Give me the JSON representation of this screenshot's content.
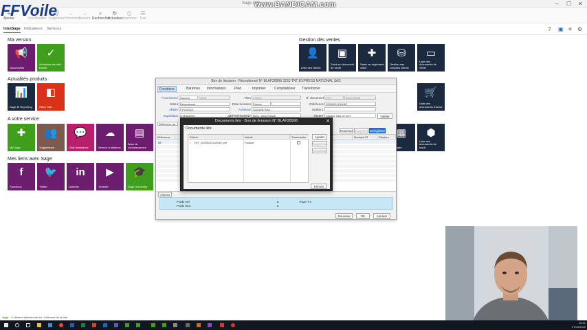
{
  "window": {
    "title": "Sage 100",
    "watermark": "www.BANDICAM.com"
  },
  "logo": {
    "text": "FFVoile"
  },
  "ribbon": {
    "buttons": [
      {
        "label": "Ajouter",
        "icon": "plus-icon"
      },
      {
        "label": "Voir/Modifier",
        "icon": "pencil-icon"
      },
      {
        "label": "Supprimer",
        "icon": "trash-icon"
      },
      {
        "label": "Précédent",
        "icon": "arrow-left-icon"
      },
      {
        "label": "Suivant",
        "icon": "arrow-right-icon"
      },
      {
        "label": "Rechercher",
        "icon": "search-icon"
      },
      {
        "label": "Actualiser",
        "icon": "refresh-icon"
      },
      {
        "label": "Imprimer",
        "icon": "printer-icon"
      },
      {
        "label": "Trier",
        "icon": "sort-icon"
      }
    ]
  },
  "subtabs": [
    "IntuiSage",
    "Indicateurs",
    "Services"
  ],
  "sections": {
    "version": "Ma version",
    "actualites": "Actualités produits",
    "service": "A votre service",
    "liens": "Mes liens avec Sage",
    "ventes": "Gestion des ventes"
  },
  "tiles": {
    "version": [
      {
        "label": "Nouveautés",
        "icon": "megaphone-icon",
        "color": "#6c1d6e"
      },
      {
        "label": "Actualiser les anti-fraude",
        "icon": "check-circle-icon",
        "color": "#3f9e1b"
      }
    ],
    "actualites": [
      {
        "label": "Sage BI Reporting",
        "icon": "bar-chart-icon",
        "color": "#1c2a40"
      },
      {
        "label": "Office 365",
        "icon": "office-icon",
        "color": "#d8331a"
      }
    ],
    "service": [
      {
        "label": "My Sage",
        "icon": "puzzle-icon",
        "color": "#3f9e1b"
      },
      {
        "label": "Suggestions",
        "icon": "people-icon",
        "color": "#7d5a4e"
      },
      {
        "label": "Chat Assistance",
        "icon": "chat-icon",
        "color": "#b8206c"
      },
      {
        "label": "Service à distance",
        "icon": "remote-icon",
        "color": "#6c1d6e"
      },
      {
        "label": "Base de connaissances",
        "icon": "book-icon",
        "color": "#6c1d6e"
      }
    ],
    "liens": [
      {
        "label": "Facebook",
        "glyph": "f",
        "icon": "facebook-icon",
        "color": "#6c1d6e"
      },
      {
        "label": "Twitter",
        "glyph": "🐦",
        "icon": "twitter-icon",
        "color": "#6c1d6e"
      },
      {
        "label": "LinkedIn",
        "glyph": "in",
        "icon": "linkedin-icon",
        "color": "#6c1d6e"
      },
      {
        "label": "Youtube",
        "glyph": "▶",
        "icon": "youtube-icon",
        "color": "#6c1d6e"
      },
      {
        "label": "Sage University",
        "glyph": "🎓",
        "icon": "graduation-icon",
        "color": "#3f9e1b"
      }
    ],
    "ventes": [
      {
        "label": "Liste des clients",
        "icon": "user-icon"
      },
      {
        "label": "Saisir un document de vente",
        "icon": "plus-doc-icon"
      },
      {
        "label": "Saisir un règlement client",
        "icon": "plus-icon"
      },
      {
        "label": "Gestion des comptes clients",
        "icon": "database-icon"
      },
      {
        "label": "Liste des documents de vente",
        "icon": "folder-icon"
      }
    ],
    "ventes_right": [
      {
        "label": "Liste des documents d'achat",
        "icon": "cart-icon"
      },
      {
        "label": "Inventaire",
        "icon": "stock-icon"
      },
      {
        "label": "Liste des documents de stock",
        "icon": "box-icon"
      }
    ]
  },
  "bl_dialog": {
    "title": "Bon de livraison : Réceptionné N° BLAF28998 3230 TNT EXPRESS NATIONAL SAS",
    "toolbar": [
      "Fonctions",
      "Barèmes",
      "Informations",
      "Pied",
      "Imprimer",
      "Comptabiliser",
      "Transformer"
    ],
    "fields": {
      "fournisseur_label": "Fournisseur",
      "fournisseur_type": "Numéro",
      "fournisseur_value": "3230",
      "tiers_label": "Tiers",
      "tiers_value": "0TNEX",
      "ndoc_label": "N° document",
      "ndoc_prefix": "FFV",
      "ndoc_value": "BLAF28998",
      "statut_label": "Statut",
      "statut_value": "Réceptionné",
      "dateliv_label": "Date livraison",
      "dateliv_value": "Prévue",
      "reference_label": "Référence",
      "reference_value": "20200241215067",
      "affaire_label": "Affaire",
      "affaire_value": "FTV01018",
      "acheteur_label": "Acheteur",
      "acheteur_value": "GAUDIN Paul",
      "entete_label": "Entête 1",
      "expedition_label": "Expédition",
      "expedition_value": "LIVRAISON",
      "depot_label": "DEPARTEMENT",
      "depot_value": "BOU - BOUTIQUE",
      "objet_label": "OBJET",
      "objet_value": "Facture frais de port",
      "valider": "Valider",
      "reference_article": "Référence art"
    },
    "grid_buttons": {
      "nouveau": "Nouveau",
      "supprimer": "Supprimer",
      "enregistrer": "Enregistrer"
    },
    "grid_headers": [
      "Référence a...",
      "",
      "",
      "",
      "",
      "",
      "Montant HT",
      "Sfacture"
    ],
    "grid_first_cell": "08",
    "actions_label": "Actions",
    "summary": {
      "poids_net": "Poids net",
      "poids_brut": "Poids brut",
      "net_value": "0",
      "brut_value": "0",
      "total_label": "Total H.T."
    },
    "footer": {
      "nouveau": "Nouveau",
      "ok": "OK",
      "annuler": "Annuler"
    }
  },
  "docs_dialog": {
    "title": "Documents liés - Bon de livraison N° BLAF28998",
    "heading": "Documents liés",
    "headers": {
      "fichier": "Fichier",
      "intitule": "Intitulé",
      "transmettre": "Transmettre"
    },
    "rows": [
      {
        "fichier": "TNT_20200241215067.pdf",
        "intitule": "Facture",
        "transmettre": false
      }
    ],
    "buttons": {
      "ajouter": "Ajouter",
      "supprimer": "Supprimer",
      "visualiser": "Visualiser",
      "fermer": "Fermer"
    }
  },
  "status": {
    "text": "0 élément sélectionné sur 1 élément de la liste",
    "brand": "sage"
  },
  "clock": {
    "time": "10:41",
    "date": "07/04/2020"
  }
}
